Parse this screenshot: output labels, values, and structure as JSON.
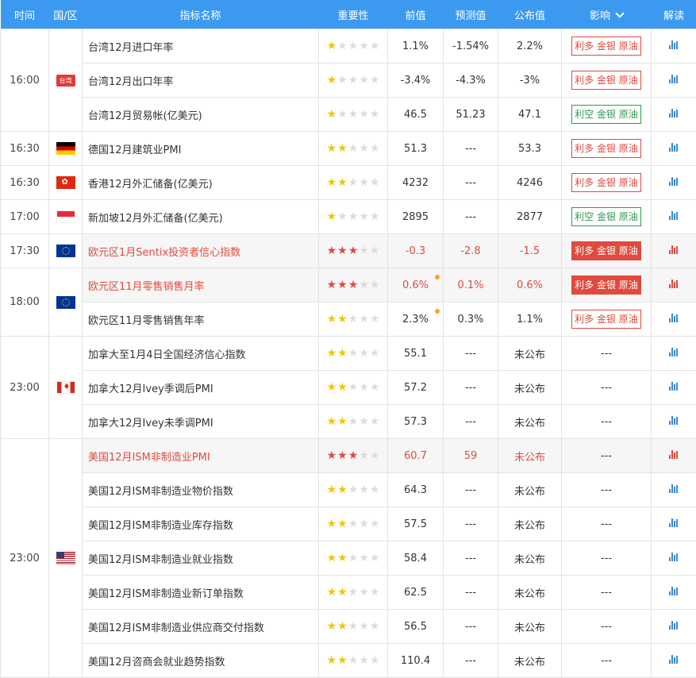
{
  "headers": {
    "time": "时间",
    "region": "国/区",
    "name": "指标名称",
    "importance": "重要性",
    "prev": "前值",
    "forecast": "预测值",
    "actual": "公布值",
    "impact": "影响",
    "analysis": "解读"
  },
  "tw_flag_text": "台湾",
  "colors": {
    "header_bg": "#3b9af0",
    "bull": "#e04a3e",
    "bear": "#2e9b4e",
    "star": "#f2c500"
  },
  "rows": [
    {
      "time": "16:00",
      "flag": "tw",
      "name": "台湾12月进口年率",
      "stars": 1,
      "prev": "1.1%",
      "forecast": "-1.54%",
      "actual": "2.2%",
      "impact": "利多 金银 原油",
      "impact_type": "bull"
    },
    {
      "name": "台湾12月出口年率",
      "stars": 1,
      "prev": "-3.4%",
      "forecast": "-4.3%",
      "actual": "-3%",
      "impact": "利多 金银 原油",
      "impact_type": "bull"
    },
    {
      "name": "台湾12月贸易帐(亿美元)",
      "stars": 1,
      "prev": "46.5",
      "forecast": "51.23",
      "actual": "47.1",
      "impact": "利空 金银 原油",
      "impact_type": "bear"
    },
    {
      "time": "16:30",
      "flag": "de",
      "name": "德国12月建筑业PMI",
      "stars": 2,
      "prev": "51.3",
      "forecast": "---",
      "actual": "53.3",
      "impact": "利多 金银 原油",
      "impact_type": "bull"
    },
    {
      "time": "16:30",
      "flag": "hk",
      "name": "香港12月外汇储备(亿美元)",
      "stars": 2,
      "prev": "4232",
      "forecast": "---",
      "actual": "4246",
      "impact": "利多 金银 原油",
      "impact_type": "bull"
    },
    {
      "time": "17:00",
      "flag": "sg",
      "name": "新加坡12月外汇储备(亿美元)",
      "stars": 1,
      "prev": "2895",
      "forecast": "---",
      "actual": "2877",
      "impact": "利空 金银 原油",
      "impact_type": "bear"
    },
    {
      "time": "17:30",
      "flag": "eu",
      "name": "欧元区1月Sentix投资者信心指数",
      "stars": 3,
      "prev": "-0.3",
      "forecast": "-2.8",
      "actual": "-1.5",
      "impact": "利多 金银 原油",
      "impact_type": "solid",
      "hl": true
    },
    {
      "time": "18:00",
      "flag": "eu",
      "name": "欧元区11月零售销售月率",
      "stars": 3,
      "prev": "0.6%",
      "forecast": "0.1%",
      "actual": "0.6%",
      "impact": "利多 金银 原油",
      "impact_type": "solid",
      "hl": true,
      "dot": true
    },
    {
      "name": "欧元区11月零售销售年率",
      "stars": 2,
      "prev": "2.3%",
      "forecast": "0.3%",
      "actual": "1.1%",
      "impact": "利多 金银 原油",
      "impact_type": "bull",
      "dot": true
    },
    {
      "time": "23:00",
      "flag": "ca",
      "name": "加拿大至1月4日全国经济信心指数",
      "stars": 2,
      "prev": "55.1",
      "forecast": "---",
      "actual": "未公布",
      "impact": "---",
      "impact_type": "none"
    },
    {
      "name": "加拿大12月Ivey季调后PMI",
      "stars": 2,
      "prev": "57.2",
      "forecast": "---",
      "actual": "未公布",
      "impact": "---",
      "impact_type": "none"
    },
    {
      "name": "加拿大12月Ivey未季调PMI",
      "stars": 2,
      "prev": "57.3",
      "forecast": "---",
      "actual": "未公布",
      "impact": "---",
      "impact_type": "none"
    },
    {
      "time": "23:00",
      "flag": "us",
      "name": "美国12月ISM非制造业PMI",
      "stars": 3,
      "prev": "60.7",
      "forecast": "59",
      "actual": "未公布",
      "impact": "---",
      "impact_type": "none",
      "hl": true
    },
    {
      "name": "美国12月ISM非制造业物价指数",
      "stars": 2,
      "prev": "64.3",
      "forecast": "---",
      "actual": "未公布",
      "impact": "---",
      "impact_type": "none"
    },
    {
      "name": "美国12月ISM非制造业库存指数",
      "stars": 2,
      "prev": "57.5",
      "forecast": "---",
      "actual": "未公布",
      "impact": "---",
      "impact_type": "none"
    },
    {
      "name": "美国12月ISM非制造业就业指数",
      "stars": 2,
      "prev": "58.4",
      "forecast": "---",
      "actual": "未公布",
      "impact": "---",
      "impact_type": "none"
    },
    {
      "name": "美国12月ISM非制造业新订单指数",
      "stars": 2,
      "prev": "62.5",
      "forecast": "---",
      "actual": "未公布",
      "impact": "---",
      "impact_type": "none"
    },
    {
      "name": "美国12月ISM非制造业供应商交付指数",
      "stars": 2,
      "prev": "56.5",
      "forecast": "---",
      "actual": "未公布",
      "impact": "---",
      "impact_type": "none"
    },
    {
      "name": "美国12月咨商会就业趋势指数",
      "stars": 2,
      "prev": "110.4",
      "forecast": "---",
      "actual": "未公布",
      "impact": "---",
      "impact_type": "none"
    }
  ]
}
